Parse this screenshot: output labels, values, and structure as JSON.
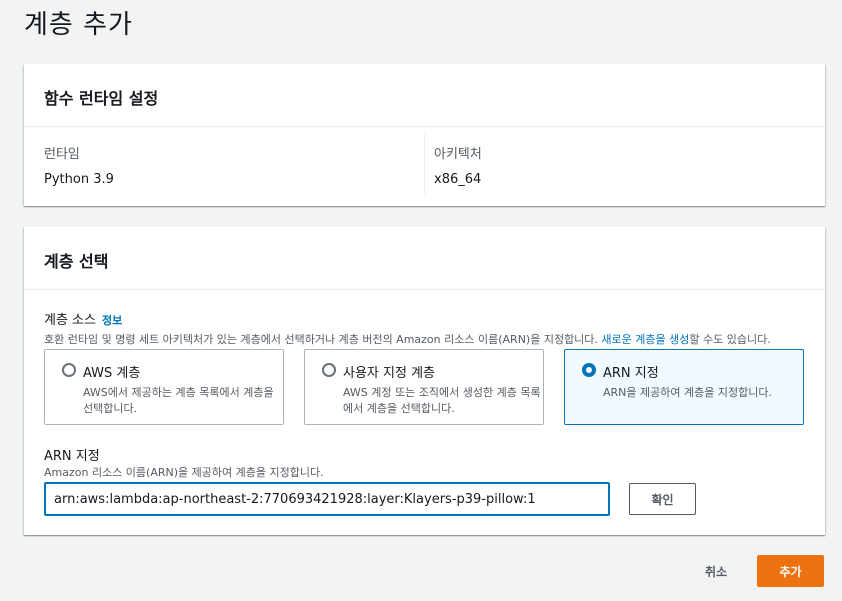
{
  "page": {
    "title": "계층 추가"
  },
  "runtime_panel": {
    "header": "함수 런타임 설정",
    "runtime_label": "런타임",
    "runtime_value": "Python 3.9",
    "arch_label": "아키텍처",
    "arch_value": "x86_64"
  },
  "layer_panel": {
    "header": "계층 선택",
    "source_label": "계층 소스",
    "info_link": "정보",
    "source_desc_prefix": "호환 런타임 및 명령 세트 아키텍처가 있는 계층에서 선택하거나 계층 버전의 Amazon 리소스 이름(ARN)을 지정합니다. ",
    "source_desc_link": "새로운 계층을 생성",
    "source_desc_suffix": "할 수도 있습니다.",
    "options": [
      {
        "title": "AWS 계층",
        "desc": "AWS에서 제공하는 계층 목록에서 계층을 선택합니다.",
        "selected": false
      },
      {
        "title": "사용자 지정 계층",
        "desc": "AWS 계정 또는 조직에서 생성한 계층 목록에서 계층을 선택합니다.",
        "selected": false
      },
      {
        "title": "ARN 지정",
        "desc": "ARN을 제공하여 계층을 지정합니다.",
        "selected": true
      }
    ],
    "arn_label": "ARN 지정",
    "arn_desc": "Amazon 리소스 이름(ARN)을 제공하여 계층을 지정합니다.",
    "arn_value": "arn:aws:lambda:ap-northeast-2:770693421928:layer:Klayers-p39-pillow:1",
    "confirm_label": "확인"
  },
  "footer": {
    "cancel_label": "취소",
    "add_label": "추가"
  },
  "colors": {
    "accent": "#0073bb",
    "primary_button": "#ec7211"
  }
}
